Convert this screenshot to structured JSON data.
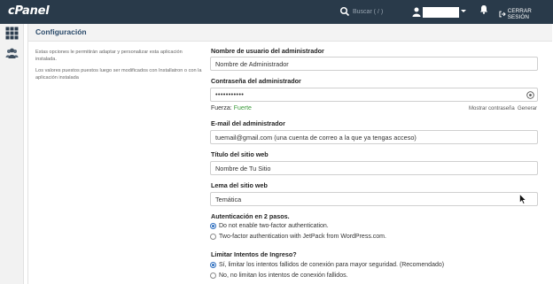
{
  "header": {
    "logo_text": "cPanel",
    "search_placeholder": "Buscar ( / )",
    "logout_label": "CERRAR SESIÓN"
  },
  "sidebar": {
    "icons": [
      "grid-icon",
      "users-icon"
    ]
  },
  "panel": {
    "title": "Configuración",
    "description_1": "Estas opciones le permitirán adaptar y personalizar esta aplicación instalada.",
    "description_2": "Los valores puestos puestos luego ser modificados con Installatron o con la aplicación instalada"
  },
  "form": {
    "admin_user": {
      "label": "Nombre de usuario del administrador",
      "value": "Nombre de Administrador"
    },
    "admin_pass": {
      "label": "Contraseña del administrador",
      "value": "•••••••••••",
      "strength_label": "Fuerza:",
      "strength_value": "Fuerte",
      "show_link": "Mostrar contraseña",
      "generate_link": "Generar"
    },
    "admin_email": {
      "label": "E-mail del administrador",
      "value": "tuemail@gmail.com (una cuenta de correo a la que ya tengas acceso)"
    },
    "site_title": {
      "label": "Título del sitio web",
      "value": "Nombre de Tu Sitio"
    },
    "site_tagline": {
      "label": "Lema del sitio web",
      "value": "Temática"
    },
    "two_factor": {
      "label": "Autenticación en 2 pasos.",
      "options": [
        {
          "label": "Do not enable two-factor authentication.",
          "selected": true
        },
        {
          "label": "Two-factor authentication with JetPack from WordPress.com.",
          "selected": false
        }
      ]
    },
    "login_limit": {
      "label": "Limitar Intentos de Ingreso?",
      "options": [
        {
          "label": "Sí, limitar los intentos fallidos de conexión para mayor seguridad. (Recomendado)",
          "selected": true
        },
        {
          "label": "No, no limitan los intentos de conexión fallidos.",
          "selected": false
        }
      ]
    }
  },
  "colors": {
    "topbar": "#293a4a",
    "title": "#2a4a6a",
    "strength_good": "#3c9b3c",
    "radio_accent": "#2f6fbf"
  }
}
